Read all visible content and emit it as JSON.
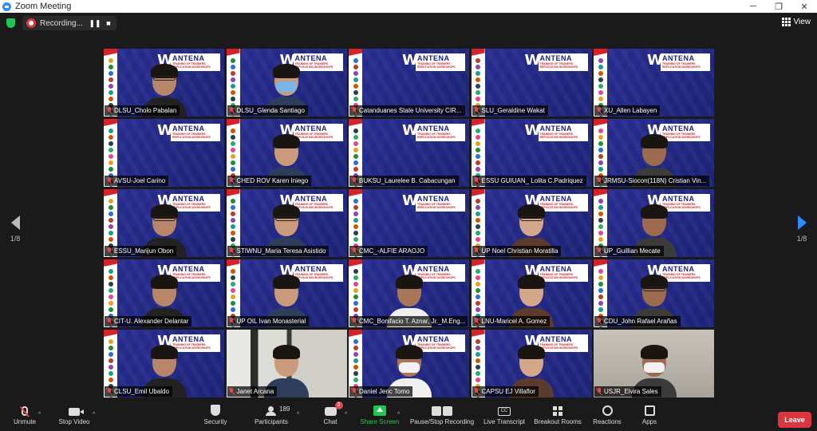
{
  "window": {
    "title": "Zoom Meeting",
    "minimize": "─",
    "maximize": "❐",
    "close": "✕"
  },
  "topbar": {
    "recording_label": "Recording...",
    "pause_symbol": "❚❚",
    "stop_symbol": "■",
    "view_label": "View"
  },
  "pager": {
    "left_label": "1/8",
    "right_label": "1/8"
  },
  "banner": {
    "brand": "ANTENA",
    "sub1": "TRAINING OF TRAINERS",
    "sub2": "REPLICATION WORKSHOPS"
  },
  "participants": [
    {
      "name": "DLSU_Cholo Pabalan"
    },
    {
      "name": "DLSU_Glenda Santiago"
    },
    {
      "name": "Catanduanes State University CIR..."
    },
    {
      "name": "SLU_Geraldine Wakat"
    },
    {
      "name": "XU_Allen Labayen"
    },
    {
      "name": "AVSU-Joel Carino"
    },
    {
      "name": "CHED ROV Karen Iniego"
    },
    {
      "name": "BUKSU_Laurelee B. Cabacungan"
    },
    {
      "name": "ESSU GUIUAN_ Lolita C.Padriquez"
    },
    {
      "name": "JRMSU-Siocon(118N) Cristian Vin..."
    },
    {
      "name": "ESSU_Marijun Obon"
    },
    {
      "name": "STIWNU_Maria Teresa Asistido"
    },
    {
      "name": "CMC_-ALFIE ARAOJO"
    },
    {
      "name": "UP Noel Christian Moratilla"
    },
    {
      "name": "UP_Guillian Mecate"
    },
    {
      "name": "CIT-U. Alexander Delantar"
    },
    {
      "name": "UP OIL Ivan Monasterial"
    },
    {
      "name": "CMC_Bonifacio T. Aznar, Jr._M.Eng..."
    },
    {
      "name": "LNU-Maricel A. Gomez"
    },
    {
      "name": "CDU_John Rafael Arañas"
    },
    {
      "name": "CLSU_Emil Ubaldo"
    },
    {
      "name": "Janet Arcana"
    },
    {
      "name": "Daniel Jeric Tomo"
    },
    {
      "name": "CAPSU EJ Villaflor"
    },
    {
      "name": "USJR_Elvira Sales"
    }
  ],
  "toolbar": {
    "unmute": "Unmute",
    "stop_video": "Stop Video",
    "security": "Security",
    "participants": "Participants",
    "participants_count": "189",
    "chat": "Chat",
    "chat_badge": "3",
    "share_screen": "Share Screen",
    "pause_stop_recording": "Pause/Stop Recording",
    "live_transcript": "Live Transcript",
    "cc": "CC",
    "breakout_rooms": "Breakout Rooms",
    "reactions": "Reactions",
    "apps": "Apps",
    "leave": "Leave",
    "caret": "^"
  },
  "colors": {
    "accent": "#2d8cff",
    "share_green": "#23c552",
    "leave_red": "#d9363e",
    "active_speaker": "#e3e67a",
    "tile_blue": "#242a8a"
  }
}
